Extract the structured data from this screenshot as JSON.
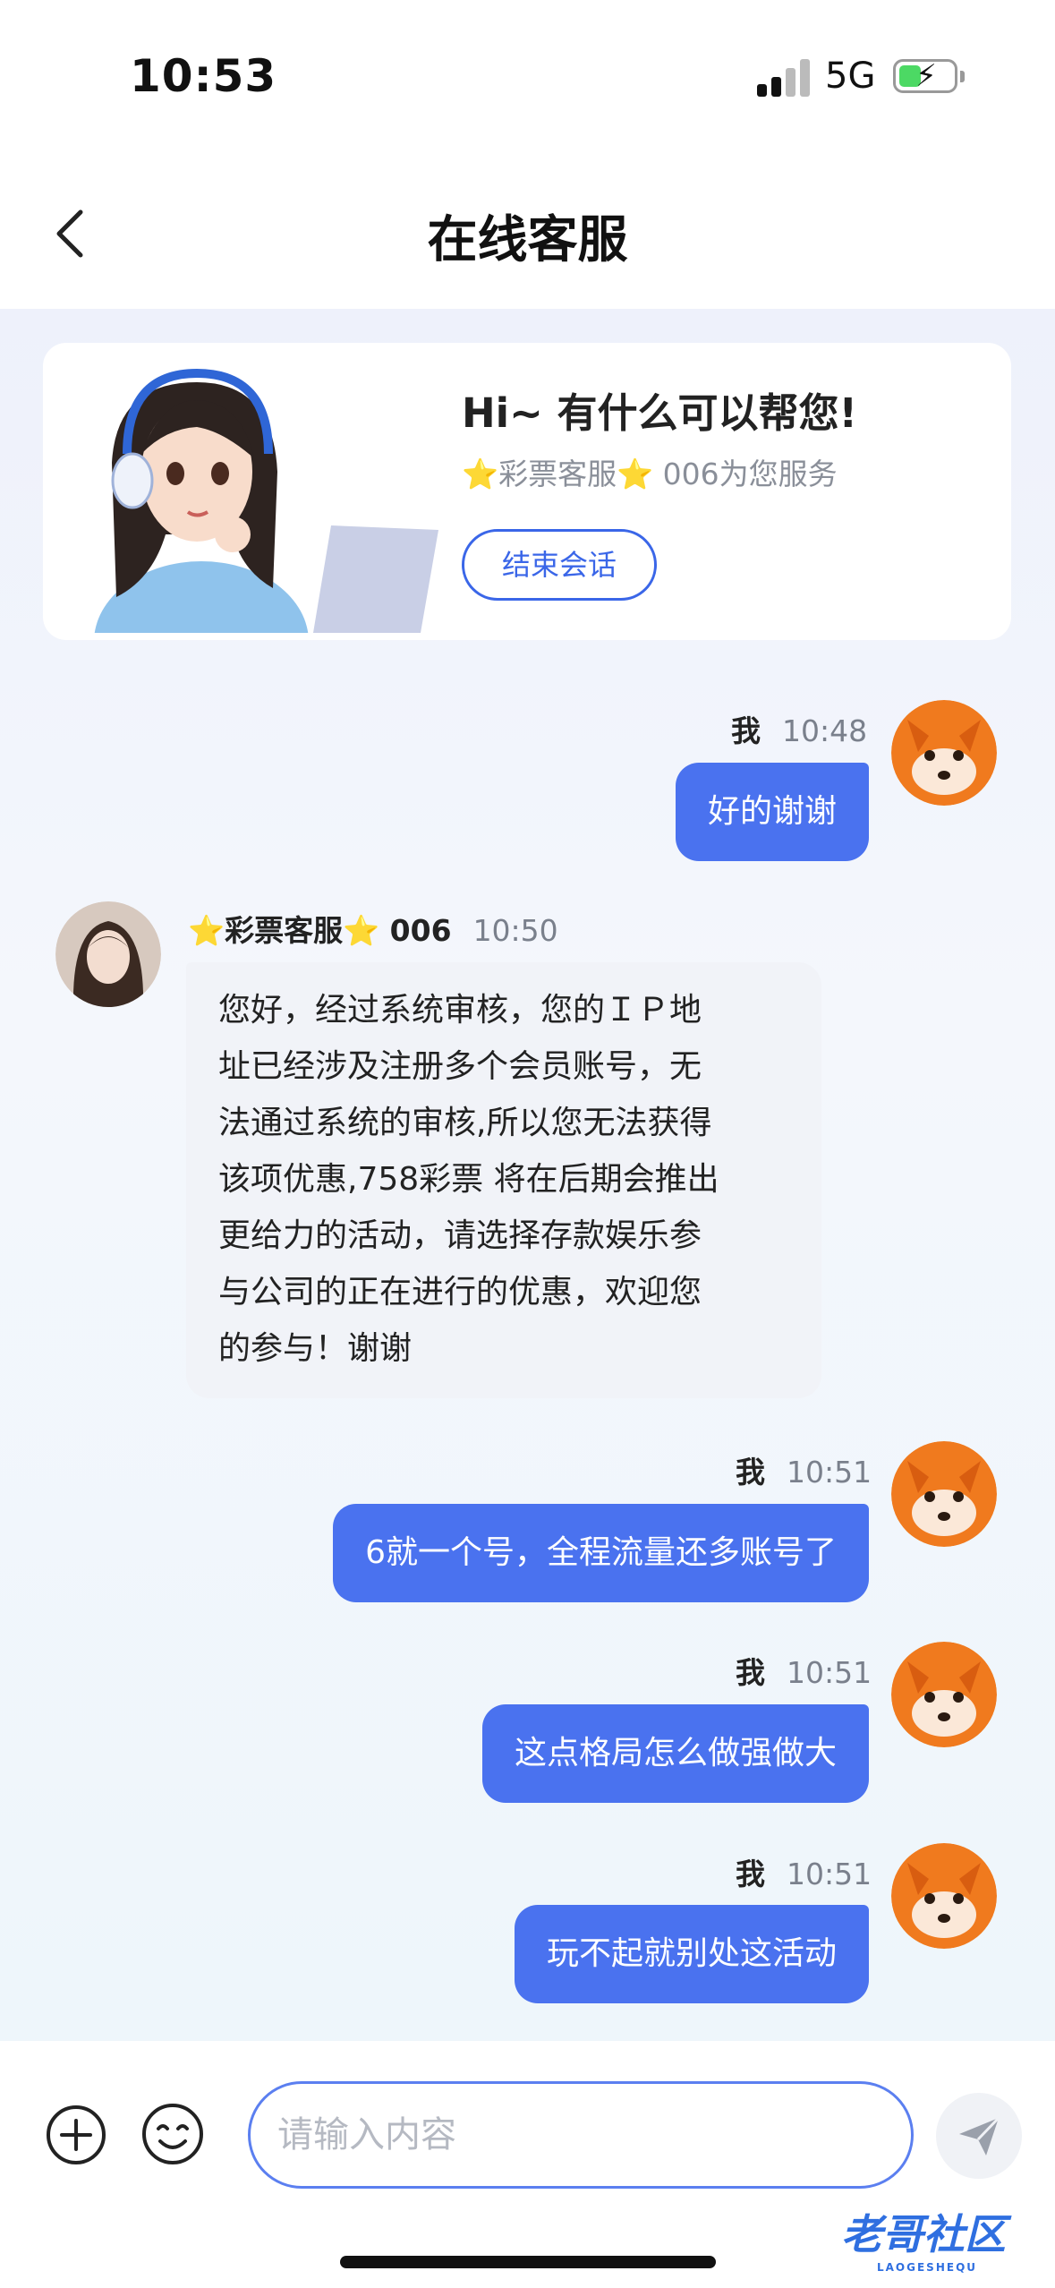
{
  "status_bar": {
    "time": "10:53",
    "network": "5G"
  },
  "nav": {
    "title": "在线客服"
  },
  "card": {
    "greeting": "Hi~ 有什么可以帮您!",
    "subtitle": "⭐彩票客服⭐ 006为您服务",
    "end_button": "结束会话"
  },
  "messages": [
    {
      "sender": "我",
      "time": "10:48",
      "text": "好的谢谢"
    },
    {
      "sender": "⭐彩票客服⭐ 006",
      "time": "10:50",
      "text": "您好，经过系统审核，您的ＩＰ地址已经涉及注册多个会员账号，无法通过系统的审核,所以您无法获得该项优惠,758彩票 将在后期会推出更给力的活动，请选择存款娱乐参与公司的正在进行的优惠，欢迎您的参与！谢谢"
    },
    {
      "sender": "我",
      "time": "10:51",
      "text": "6就一个号，全程流量还多账号了"
    },
    {
      "sender": "我",
      "time": "10:51",
      "text": "这点格局怎么做强做大"
    },
    {
      "sender": "我",
      "time": "10:51",
      "text": "玩不起就别处这活动"
    }
  ],
  "agent_message_lines": [
    "您好，经过系统审核，您的ＩＰ地",
    "址已经涉及注册多个会员账号，无",
    "法通过系统的审核,所以您无法获得",
    "该项优惠,758彩票 将在后期会推出",
    "更给力的活动，请选择存款娱乐参",
    "与公司的正在进行的优惠，欢迎您",
    "的参与！谢谢"
  ],
  "input": {
    "placeholder": "请输入内容"
  },
  "watermark": {
    "text": "老哥社区",
    "sub": "LAOGESHEQU"
  },
  "colors": {
    "accent": "#4a72ef",
    "bubble_agent": "#f1f3f8",
    "fox": "#f07a1e"
  },
  "icons": [
    "back-icon",
    "plus-icon",
    "emoji-icon",
    "send-icon",
    "fox-avatar",
    "agent-avatar"
  ]
}
